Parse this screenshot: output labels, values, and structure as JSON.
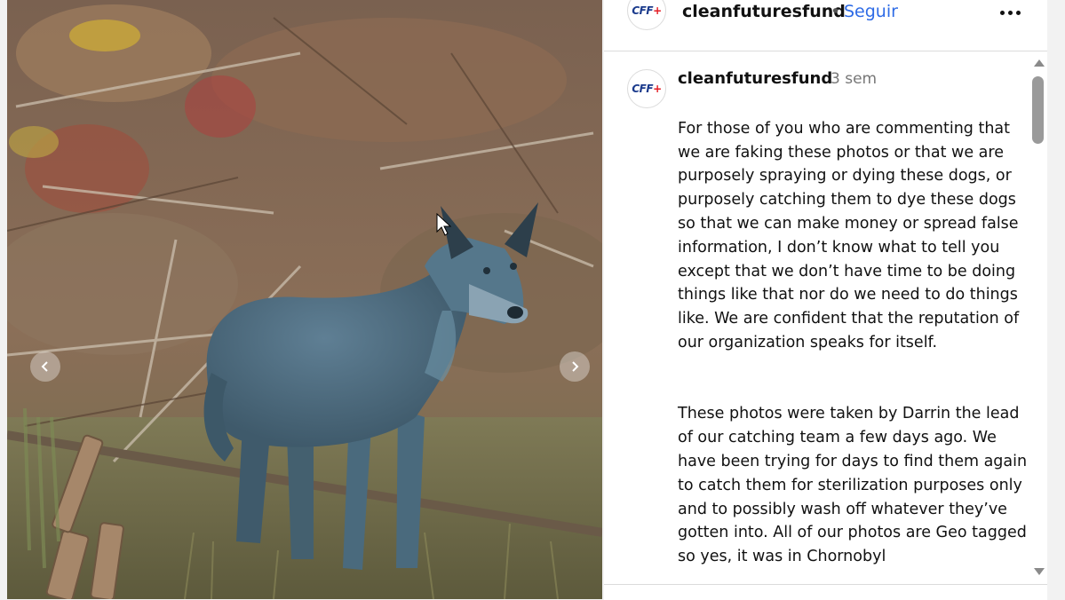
{
  "post": {
    "account": {
      "username": "cleanfuturesfund",
      "separator": "•",
      "follow_label": "Seguir",
      "logo_text": "CFF",
      "logo_plus": "+"
    },
    "more_icon": "more-horizontal-icon"
  },
  "caption": {
    "username": "cleanfuturesfund",
    "time": "3 sem",
    "paragraphs": [
      "For those of you who are commenting that we are faking these photos or that we are purposely spraying or dying these dogs, or purposely catching them to dye these dogs so that we can make money or spread false information, I don’t know what to tell you except that we don’t have time to be doing things like that nor do we need to do things like. We are confident that the reputation of our organization speaks for itself.",
      "These photos were taken by Darrin the lead of our catching team a few days ago. We have been trying for days to find them again to catch them for sterilization purposes only and to possibly wash off whatever they’ve gotten into. All of our photos are Geo tagged so yes, it was in Chornobyl"
    ]
  },
  "media": {
    "prev_icon": "chevron-left-icon",
    "next_icon": "chevron-right-icon",
    "colors": {
      "dog": "#4f6f86",
      "brush": "#8a6e56",
      "accent_red": "#a52a2a"
    }
  },
  "colors": {
    "follow": "#2e6be6",
    "border": "#dbdbdb",
    "time": "#777777"
  }
}
